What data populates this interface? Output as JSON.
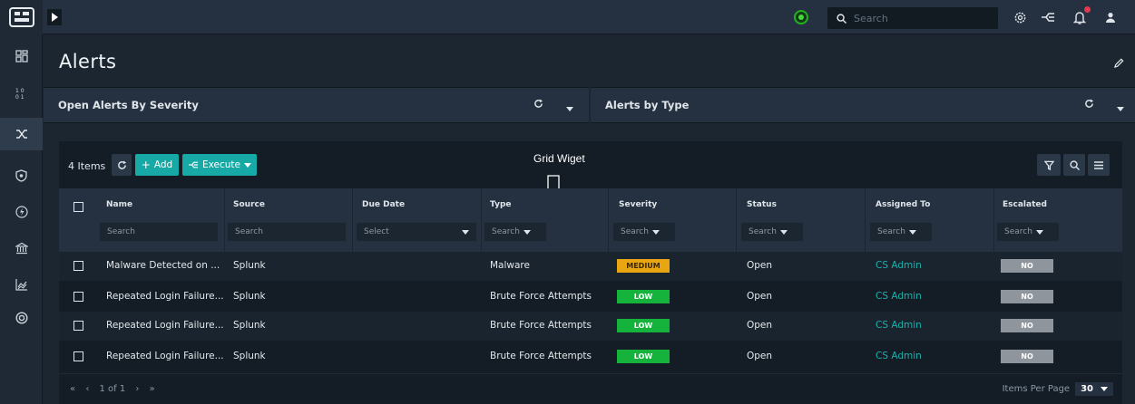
{
  "icons": {
    "logo": "logo-icon",
    "expand": "play-icon",
    "status": "status-indicator-icon",
    "search": "search-icon",
    "settings": "gear-icon",
    "workflow": "workflow-icon",
    "notifications": "bell-icon",
    "user": "user-icon",
    "edit": "pencil-icon"
  },
  "topbar": {
    "search_placeholder": "Search"
  },
  "sidebar": {
    "items": [
      {
        "name": "dashboard",
        "icon": "dashboard-icon"
      },
      {
        "name": "queue",
        "icon": "sort-icon"
      },
      {
        "name": "incidents",
        "icon": "shuffle-icon"
      },
      {
        "name": "security",
        "icon": "shield-icon"
      },
      {
        "name": "automation",
        "icon": "lightning-icon"
      },
      {
        "name": "resources",
        "icon": "bank-icon"
      },
      {
        "name": "reports",
        "icon": "chart-icon"
      },
      {
        "name": "system",
        "icon": "help-icon"
      }
    ]
  },
  "page": {
    "title": "Alerts"
  },
  "widgets": {
    "left_title": "Open Alerts By Severity",
    "right_title": "Alerts by Type"
  },
  "grid": {
    "items_label": "4 Items",
    "add_label": "Add",
    "execute_label": "Execute",
    "annotation": "Grid Wiget",
    "columns": [
      {
        "title": "Name",
        "filter": "Search"
      },
      {
        "title": "Source",
        "filter": "Search"
      },
      {
        "title": "Due Date",
        "filter": "Select"
      },
      {
        "title": "Type",
        "filter": "Search"
      },
      {
        "title": "Severity",
        "filter": "Search"
      },
      {
        "title": "Status",
        "filter": "Search"
      },
      {
        "title": "Assigned To",
        "filter": "Search"
      },
      {
        "title": "Escalated",
        "filter": "Search"
      }
    ],
    "rows": [
      {
        "name": "Malware Detected on ...",
        "source": "Splunk",
        "due": "",
        "type": "Malware",
        "severity": "MEDIUM",
        "status": "Open",
        "assigned": "CS Admin",
        "escalated": "NO"
      },
      {
        "name": "Repeated Login Failure...",
        "source": "Splunk",
        "due": "",
        "type": "Brute Force Attempts",
        "severity": "LOW",
        "status": "Open",
        "assigned": "CS Admin",
        "escalated": "NO"
      },
      {
        "name": "Repeated Login Failure...",
        "source": "Splunk",
        "due": "",
        "type": "Brute Force Attempts",
        "severity": "LOW",
        "status": "Open",
        "assigned": "CS Admin",
        "escalated": "NO"
      },
      {
        "name": "Repeated Login Failure...",
        "source": "Splunk",
        "due": "",
        "type": "Brute Force Attempts",
        "severity": "LOW",
        "status": "Open",
        "assigned": "CS Admin",
        "escalated": "NO"
      }
    ],
    "footer": {
      "page_info": "1 of 1",
      "per_page_label": "Items Per Page",
      "per_page_value": "30"
    }
  },
  "colors": {
    "accent": "#17a9a6",
    "medium": "#e8a712",
    "low": "#16b33c",
    "link": "#19b2ad"
  }
}
